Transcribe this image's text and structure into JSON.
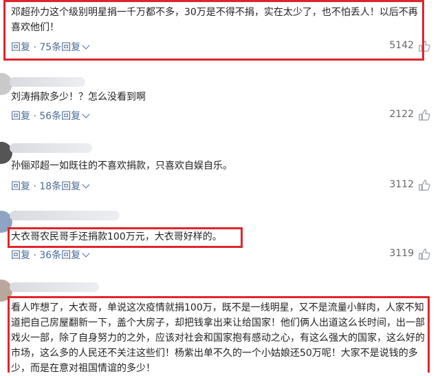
{
  "comments": [
    {
      "text": "邓超孙力这个级别明星捐一千万都不多，30万是不得不捐，实在太少了，也不怕丢人！以后不再喜欢他们！",
      "reply_label": "回复",
      "replies": "75条回复",
      "likes": "5142",
      "highlighted": true
    },
    {
      "text": "刘涛捐款多少！？怎么没看到啊",
      "reply_label": "回复",
      "replies": "56条回复",
      "likes": "2122",
      "highlighted": false
    },
    {
      "text": "孙俪邓超一如既往的不喜欢捐款，只喜欢自娱自乐。",
      "reply_label": "回复",
      "replies": "18条回复",
      "likes": "3112",
      "highlighted": false
    },
    {
      "text": "大衣哥农民哥手还捐款100万元，大衣哥好样的。",
      "reply_label": "回复",
      "replies": "36条回复",
      "likes": "3119",
      "highlighted": true
    },
    {
      "text": "看人咋想了，大衣哥，单说这次疫情就捐100万，既不是一线明星，又不是流量小鲜肉，人家不知道把自己房屋翻新一下，盖个大房子，却把钱拿出来让给国家！他们俩人出道这么长时间，出一部戏火一部，除了自身努力的之外，应该对社会和国家抱有感动之心，有这么强大的国家，这么好的市场，这么多的人民还不关注这些们！杨紫出单不久的一个小姑娘还50万呢！大家不是说钱的多少，而是在意对祖国情谊的多少！",
      "highlighted": true
    }
  ],
  "separator": "·",
  "colors": {
    "highlight": "#e0242b",
    "link": "#4a6a99"
  }
}
